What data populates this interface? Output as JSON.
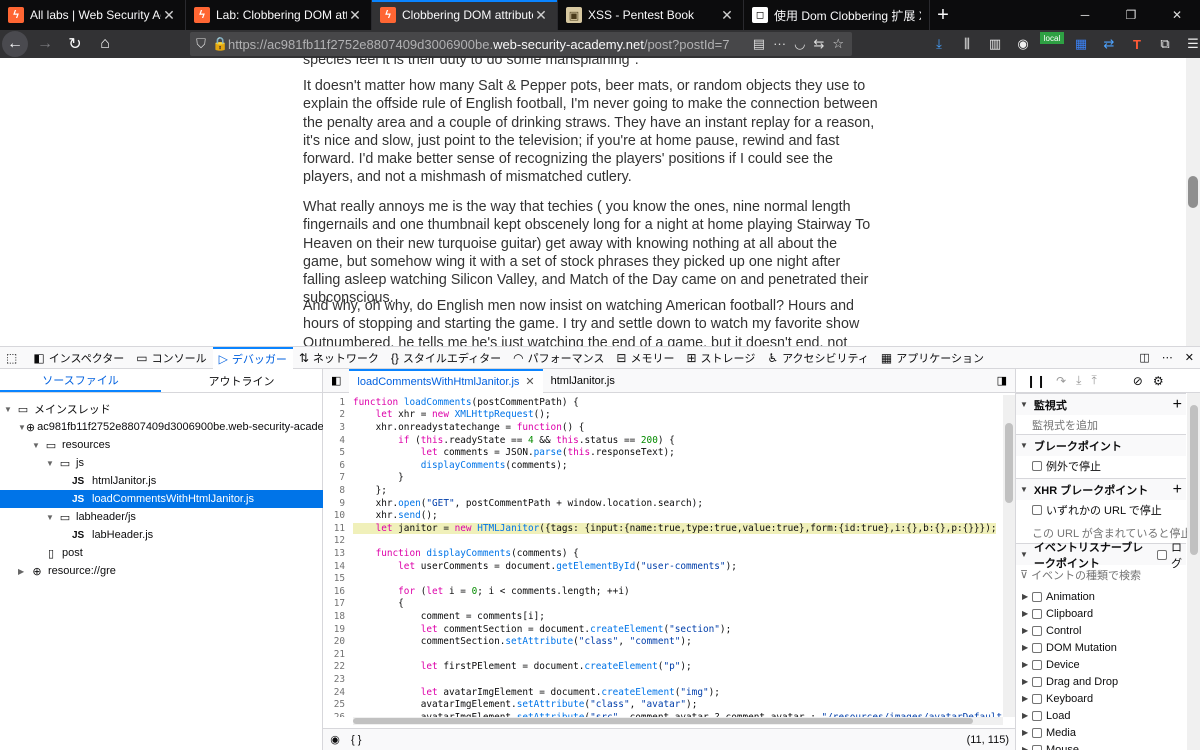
{
  "tabs": [
    {
      "label": "All labs | Web Security Academ",
      "favicon": "burp"
    },
    {
      "label": "Lab: Clobbering DOM attribute",
      "favicon": "burp"
    },
    {
      "label": "Clobbering DOM attributes to b",
      "favicon": "burp",
      "active": true
    },
    {
      "label": "XSS - Pentest Book",
      "favicon": "xss"
    },
    {
      "label": "使用 Dom Clobbering 扩展 XSS - Ze",
      "favicon": "z"
    }
  ],
  "url": {
    "prefix": "https://ac981fb11f2752e8807409d3006900be.",
    "domain": "web-security-academy.net",
    "path": "/post?postId=7"
  },
  "toolbar_badge": "local",
  "article": {
    "top_fragment": "species feel it is their duty to do some mansplaining\".",
    "paragraphs": [
      "It doesn't matter how many Salt & Pepper pots, beer mats, or random objects they use to explain the offside rule of English football, I'm never going to make the connection between the penalty area and a couple of drinking straws. They have an instant replay for a reason, it's nice and slow, just point to the television; if you're at home pause, rewind and fast forward. I'd make better sense of recognizing the players' positions if I could see the players, and not a mishmash of mismatched cutlery.",
      "What really annoys me is the way that techies ( you know the ones, nine normal length fingernails and one thumbnail kept obscenely long for a night at home playing Stairway To Heaven on their new turquoise guitar) get away with knowing nothing at all about the game, but somehow wing it with a set of stock phrases they picked up one night after falling asleep watching Silicon Valley, and Match of the Day came on and penetrated their subconscious.",
      "And why, oh why, do English men now insist on watching American football? Hours and hours of stopping and starting the game. I try and settle down to watch my favorite show Outnumbered, he tells me he's just watching the end of a game, but it doesn't end, not before it's already time to get"
    ]
  },
  "devtools": {
    "tabs": [
      "インスペクター",
      "コンソール",
      "デバッガー",
      "ネットワーク",
      "スタイルエディター",
      "パフォーマンス",
      "メモリー",
      "ストレージ",
      "アクセシビリティ",
      "アプリケーション"
    ],
    "active_tab": "デバッガー",
    "left_tabs": [
      "ソースファイル",
      "アウトライン"
    ],
    "tree": [
      {
        "label": "メインスレッド",
        "level": 0,
        "icon": "thread"
      },
      {
        "label": "ac981fb11f2752e8807409d3006900be.web-security-academy.net",
        "level": 1,
        "icon": "globe"
      },
      {
        "label": "resources",
        "level": 2,
        "icon": "folder"
      },
      {
        "label": "js",
        "level": 3,
        "icon": "folder"
      },
      {
        "label": "htmlJanitor.js",
        "level": 4,
        "icon": "js"
      },
      {
        "label": "loadCommentsWithHtmlJanitor.js",
        "level": 4,
        "icon": "js",
        "selected": true
      },
      {
        "label": "labheader/js",
        "level": 3,
        "icon": "folder"
      },
      {
        "label": "labHeader.js",
        "level": 4,
        "icon": "js"
      },
      {
        "label": "post",
        "level": 2,
        "icon": "file"
      },
      {
        "label": "resource://gre",
        "level": 1,
        "icon": "globe"
      }
    ],
    "editor_tabs": [
      "loadCommentsWithHtmlJanitor.js",
      "htmlJanitor.js"
    ],
    "code_lines": [
      "function loadComments(postCommentPath) {",
      "    let xhr = new XMLHttpRequest();",
      "    xhr.onreadystatechange = function() {",
      "        if (this.readyState == 4 && this.status == 200) {",
      "            let comments = JSON.parse(this.responseText);",
      "            displayComments(comments);",
      "        }",
      "    };",
      "    xhr.open(\"GET\", postCommentPath + window.location.search);",
      "    xhr.send();",
      "    let janitor = new HTMLJanitor({tags: {input:{name:true,type:true,value:true},form:{id:true},i:{},b:{},p:{}}});",
      "",
      "    function displayComments(comments) {",
      "        let userComments = document.getElementById(\"user-comments\");",
      "",
      "        for (let i = 0; i < comments.length; ++i)",
      "        {",
      "            comment = comments[i];",
      "            let commentSection = document.createElement(\"section\");",
      "            commentSection.setAttribute(\"class\", \"comment\");",
      "",
      "            let firstPElement = document.createElement(\"p\");",
      "",
      "            let avatarImgElement = document.createElement(\"img\");",
      "            avatarImgElement.setAttribute(\"class\", \"avatar\");",
      "            avatarImgElement.setAttribute(\"src\", comment.avatar ? comment.avatar : \"/resources/images/avatarDefault.svg\");",
      ""
    ],
    "highlight_line": 11,
    "footer_left": "{ }",
    "cursor": "(11, 115)",
    "right": {
      "watch_title": "監視式",
      "watch_placeholder": "監視式を追加",
      "bp_title": "ブレークポイント",
      "bp_exception": "例外で停止",
      "xhr_title": "XHR ブレークポイント",
      "xhr_any": "いずれかの URL で停止",
      "xhr_hint": "この URL が含まれていると停止",
      "ev_title": "イベントリスナーブレークポイント",
      "ev_log": "ログ",
      "ev_filter": "イベントの種類で検索",
      "events": [
        "Animation",
        "Clipboard",
        "Control",
        "DOM Mutation",
        "Device",
        "Drag and Drop",
        "Keyboard",
        "Load",
        "Media",
        "Mouse"
      ]
    }
  }
}
